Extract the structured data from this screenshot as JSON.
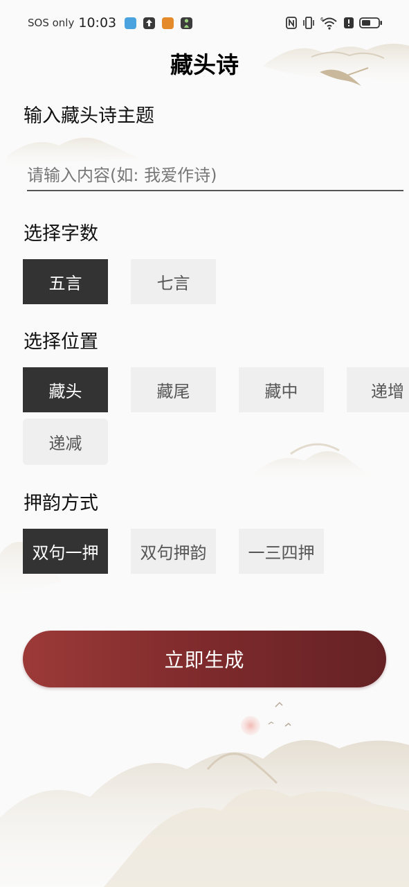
{
  "status_bar": {
    "carrier": "SOS only",
    "time": "10:03",
    "app_icons": [
      "photo-app-icon",
      "upload-app-icon",
      "novel-app-icon",
      "figure-app-icon"
    ],
    "right_icons": [
      "nfc-icon",
      "vibrate-icon",
      "wifi-6-icon",
      "alert-icon",
      "battery-icon"
    ]
  },
  "header": {
    "title": "藏头诗"
  },
  "topic": {
    "label": "输入藏头诗主题",
    "placeholder": "请输入内容(如: 我爱作诗)",
    "value": ""
  },
  "word_count": {
    "label": "选择字数",
    "options": [
      "五言",
      "七言"
    ],
    "selected": "五言"
  },
  "position": {
    "label": "选择位置",
    "options": [
      "藏头",
      "藏尾",
      "藏中",
      "递增",
      "递减"
    ],
    "selected": "藏头"
  },
  "rhyme": {
    "label": "押韵方式",
    "options": [
      "双句一押",
      "双句押韵",
      "一三四押"
    ],
    "selected": "双句一押"
  },
  "actions": {
    "generate_label": "立即生成"
  },
  "colors": {
    "selected_chip": "#333333",
    "unselected_chip": "#efefef",
    "button_gradient_start": "#9c3a38",
    "button_gradient_end": "#652224"
  }
}
